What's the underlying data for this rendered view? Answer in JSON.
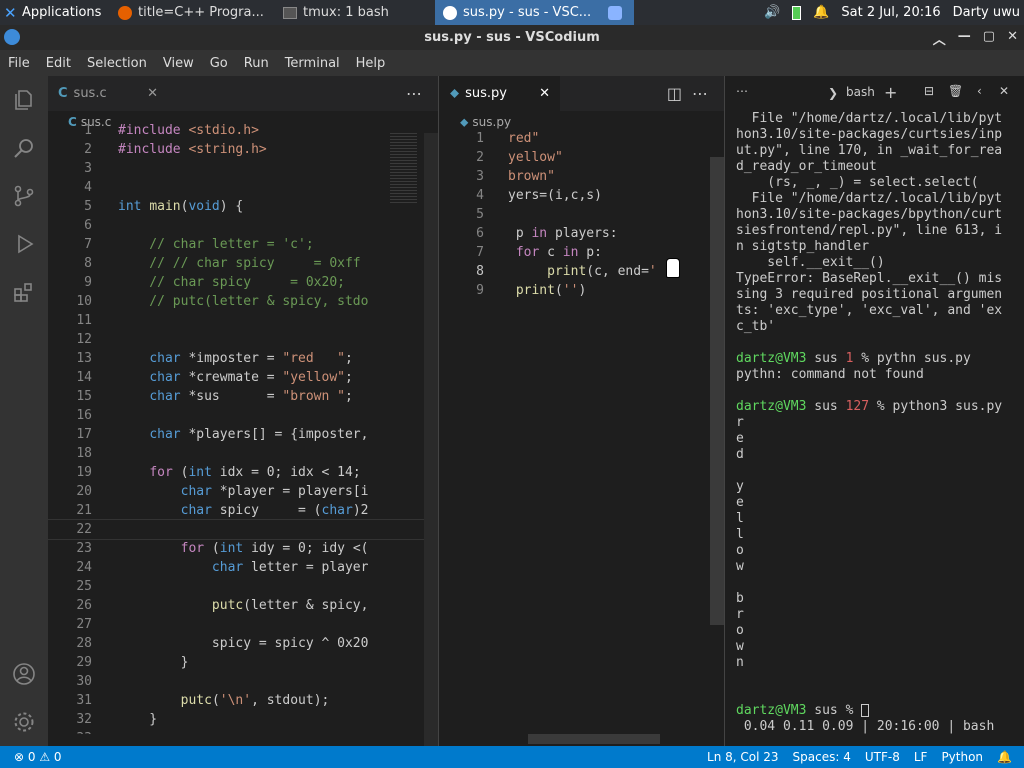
{
  "taskbar": {
    "apps_label": "Applications",
    "tasks": [
      {
        "label": "title=C++ Progra..."
      },
      {
        "label": "tmux: 1 bash"
      },
      {
        "label": "sus.py - sus - VSC..."
      }
    ],
    "clock": "Sat  2 Jul, 20:16",
    "user": "Darty uwu"
  },
  "window": {
    "title": "sus.py - sus - VSCodium"
  },
  "menu": [
    "File",
    "Edit",
    "Selection",
    "View",
    "Go",
    "Run",
    "Terminal",
    "Help"
  ],
  "editor1": {
    "tab": "sus.c",
    "breadcrumb": "sus.c",
    "lines": [
      {
        "n": "1",
        "t": "#include <stdio.h>"
      },
      {
        "n": "2",
        "t": "#include <string.h>"
      },
      {
        "n": "3",
        "t": ""
      },
      {
        "n": "4",
        "t": ""
      },
      {
        "n": "5",
        "t": "int main(void) {"
      },
      {
        "n": "6",
        "t": ""
      },
      {
        "n": "7",
        "t": "    // char letter = 'c';"
      },
      {
        "n": "8",
        "t": "    // // char spicy     = 0xff"
      },
      {
        "n": "9",
        "t": "    // char spicy     = 0x20;"
      },
      {
        "n": "10",
        "t": "    // putc(letter & spicy, stdo"
      },
      {
        "n": "11",
        "t": ""
      },
      {
        "n": "12",
        "t": ""
      },
      {
        "n": "13",
        "t": "    char *imposter = \"red   \";"
      },
      {
        "n": "14",
        "t": "    char *crewmate = \"yellow\";"
      },
      {
        "n": "15",
        "t": "    char *sus      = \"brown \";"
      },
      {
        "n": "16",
        "t": ""
      },
      {
        "n": "17",
        "t": "    char *players[] = {imposter,"
      },
      {
        "n": "18",
        "t": ""
      },
      {
        "n": "19",
        "t": "    for (int idx = 0; idx < 14;"
      },
      {
        "n": "20",
        "t": "        char *player = players[i"
      },
      {
        "n": "21",
        "t": "        char spicy     = (char)2"
      },
      {
        "n": "22",
        "t": ""
      },
      {
        "n": "23",
        "t": "        for (int idy = 0; idy <("
      },
      {
        "n": "24",
        "t": "            char letter = player"
      },
      {
        "n": "25",
        "t": ""
      },
      {
        "n": "26",
        "t": "            putc(letter & spicy,"
      },
      {
        "n": "27",
        "t": ""
      },
      {
        "n": "28",
        "t": "            spicy = spicy ^ 0x20"
      },
      {
        "n": "29",
        "t": "        }"
      },
      {
        "n": "30",
        "t": ""
      },
      {
        "n": "31",
        "t": "        putc('\\n', stdout);"
      },
      {
        "n": "32",
        "t": "    }"
      },
      {
        "n": "33",
        "t": ""
      }
    ]
  },
  "editor2": {
    "tab": "sus.py",
    "breadcrumb": "sus.py",
    "lines": [
      {
        "n": "1",
        "t": "red\""
      },
      {
        "n": "2",
        "t": "yellow\""
      },
      {
        "n": "3",
        "t": "brown\""
      },
      {
        "n": "4",
        "t": "yers=(i,c,s)"
      },
      {
        "n": "5",
        "t": ""
      },
      {
        "n": "6",
        "t": " p in players:"
      },
      {
        "n": "7",
        "t": " for c in p:"
      },
      {
        "n": "8",
        "t": "     print(c, end='"
      },
      {
        "n": "9",
        "t": " print('')"
      }
    ]
  },
  "terminal": {
    "shell_label": "bash",
    "lines": [
      "  File \"/home/dartz/.local/lib/pyt",
      "hon3.10/site-packages/curtsies/inp",
      "ut.py\", line 170, in _wait_for_rea",
      "d_ready_or_timeout",
      "    (rs, _, _) = select.select(",
      "  File \"/home/dartz/.local/lib/pyt",
      "hon3.10/site-packages/bpython/curt",
      "siesfrontend/repl.py\", line 613, i",
      "n sigtstp_handler",
      "    self.__exit__()",
      "TypeError: BaseRepl.__exit__() mis",
      "sing 3 required positional argumen",
      "ts: 'exc_type', 'exc_val', and 'ex",
      "c_tb'",
      "",
      "dartz@VM3 sus 1 % pythn sus.py",
      "pythn: command not found",
      "",
      "dartz@VM3 sus 127 % python3 sus.py",
      "r",
      "e",
      "d",
      "",
      "y",
      "e",
      "l",
      "l",
      "o",
      "w",
      "",
      "b",
      "r",
      "o",
      "w",
      "n",
      "",
      "",
      "dartz@VM3 sus % ",
      " 0.04 0.11 0.09 | 20:16:00 | bash"
    ]
  },
  "status": {
    "problems": "⊗ 0 ⚠ 0",
    "position": "Ln 8, Col 23",
    "spaces": "Spaces: 4",
    "encoding": "UTF-8",
    "eol": "LF",
    "language": "Python"
  }
}
